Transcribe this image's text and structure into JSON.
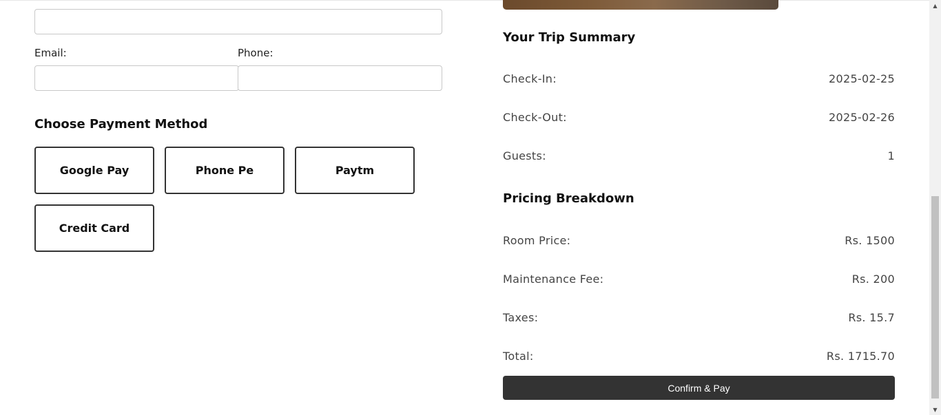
{
  "form": {
    "email_label": "Email:",
    "phone_label": "Phone:",
    "email_value": "",
    "phone_value": "",
    "top_value": ""
  },
  "payment": {
    "title": "Choose Payment Method",
    "methods": [
      "Google Pay",
      "Phone Pe",
      "Paytm",
      "Credit Card"
    ]
  },
  "summary": {
    "title": "Your Trip Summary",
    "rows": [
      {
        "label": "Check-In:",
        "value": "2025-02-25"
      },
      {
        "label": "Check-Out:",
        "value": "2025-02-26"
      },
      {
        "label": "Guests:",
        "value": "1"
      }
    ]
  },
  "pricing": {
    "title": "Pricing Breakdown",
    "rows": [
      {
        "label": "Room Price:",
        "value": "Rs. 1500"
      },
      {
        "label": "Maintenance Fee:",
        "value": "Rs. 200"
      },
      {
        "label": "Taxes:",
        "value": "Rs. 15.7"
      },
      {
        "label": "Total:",
        "value": "Rs. 1715.70"
      }
    ]
  },
  "confirm_label": "Confirm & Pay",
  "scrollbar": {
    "up_icon": "▲",
    "down_icon": "▼"
  }
}
